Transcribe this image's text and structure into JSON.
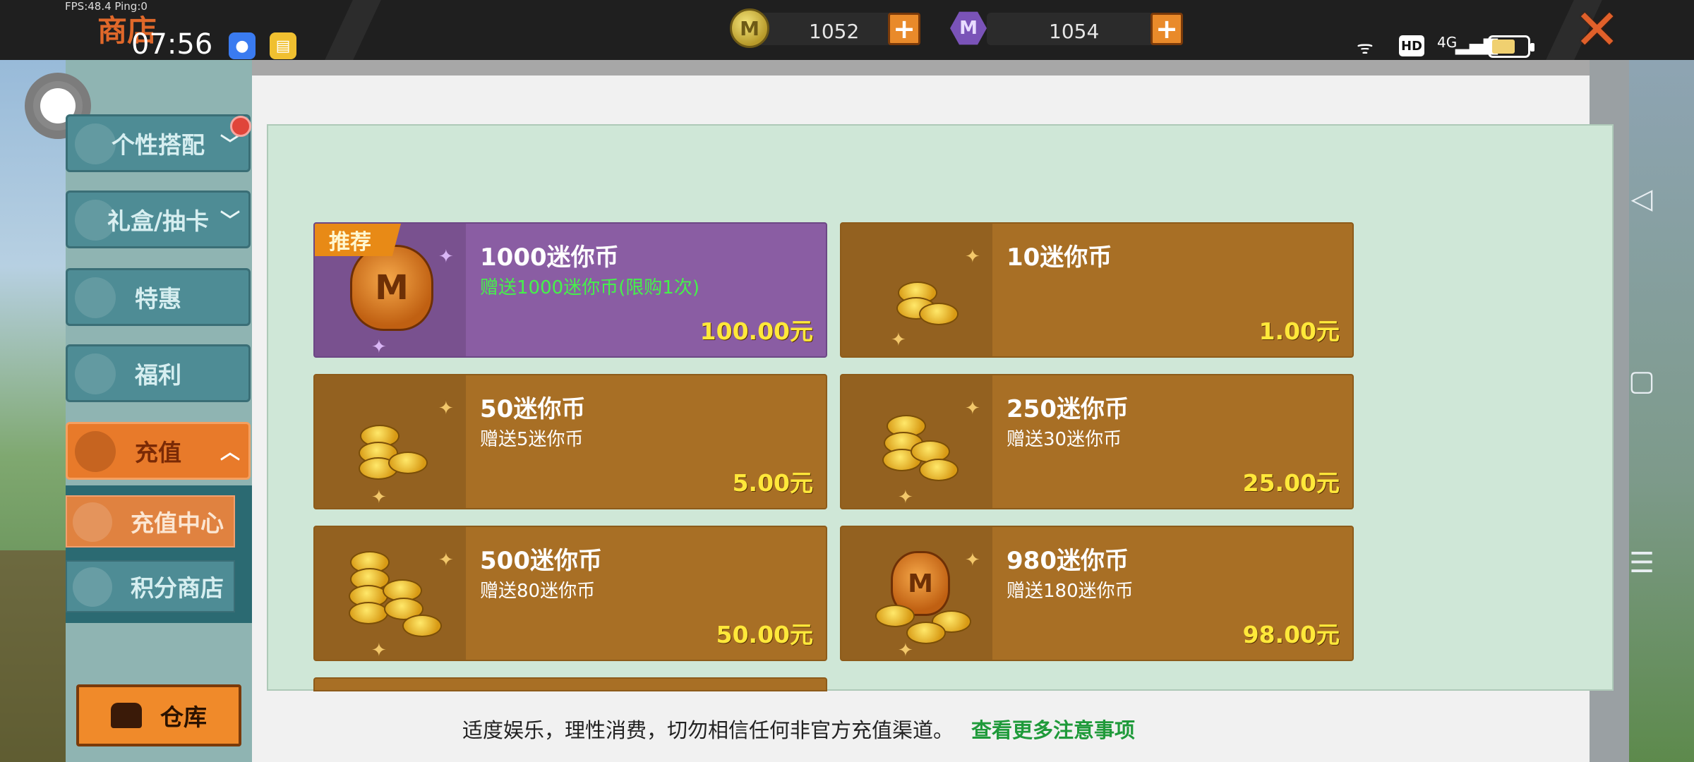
{
  "debug": {
    "fps": "FPS:48.4  Ping:0"
  },
  "header": {
    "title": "商店"
  },
  "status_bar": {
    "time": "07:56",
    "network": "4G"
  },
  "currency": {
    "mini_coins": "1052",
    "mini_points": "1054"
  },
  "sidebar": {
    "items": [
      {
        "label": "个性搭配",
        "chevron": "﹀"
      },
      {
        "label": "礼盒/抽卡",
        "chevron": "﹀"
      },
      {
        "label": "特惠"
      },
      {
        "label": "福利"
      },
      {
        "label": "充值",
        "chevron": "︿"
      }
    ],
    "sub_items": [
      {
        "label": "充值中心"
      },
      {
        "label": "积分商店"
      }
    ],
    "warehouse_label": "仓库"
  },
  "products": [
    {
      "name": "1000迷你币",
      "bonus": "赠送1000迷你币(限购1次)",
      "price": "100.00元",
      "badge": "推荐"
    },
    {
      "name": "10迷你币",
      "bonus": "",
      "price": "1.00元"
    },
    {
      "name": "50迷你币",
      "bonus": "赠送5迷你币",
      "price": "5.00元"
    },
    {
      "name": "250迷你币",
      "bonus": "赠送30迷你币",
      "price": "25.00元"
    },
    {
      "name": "500迷你币",
      "bonus": "赠送80迷你币",
      "price": "50.00元"
    },
    {
      "name": "980迷你币",
      "bonus": "赠送180迷你币",
      "price": "98.00元"
    }
  ],
  "footer": {
    "notice": "适度娱乐，理性消费，切勿相信任何非官方充值渠道。",
    "link": "查看更多注意事项"
  },
  "icons": {
    "coin": "coin-icon",
    "points": "hex-m-icon",
    "plus": "plus-icon",
    "close": "close-icon"
  },
  "colors": {
    "accent_orange": "#e98a2a",
    "card_brown": "#a86f25",
    "card_purple": "#8a5da3",
    "bonus_green": "#45f24a",
    "price_yellow": "#ffe83a",
    "link_green": "#1f9a3a"
  }
}
